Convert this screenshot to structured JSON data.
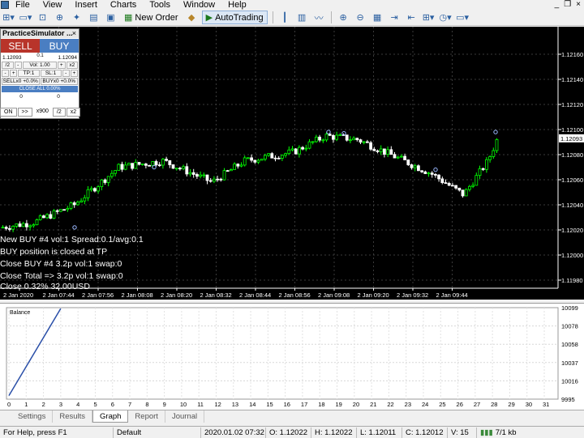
{
  "menu": {
    "items": [
      "File",
      "View",
      "Insert",
      "Charts",
      "Tools",
      "Window",
      "Help"
    ],
    "window_controls": [
      "_",
      "❐",
      "×"
    ]
  },
  "toolbar": {
    "new_order": "New Order",
    "autotrading": "AutoTrading"
  },
  "simulator": {
    "title": "PracticeSimulator ...",
    "close": "×",
    "sell": "SELL",
    "buy": "BUY",
    "spread": "0.1",
    "bid": "1.12093",
    "ask": "1.12094",
    "half": "/2",
    "vol": "Vol: 1.00",
    "double": "x2",
    "tp": "TP:1",
    "sl": "SL:1",
    "minus": "-",
    "plus": "+",
    "sell_status": "SELLx0 +0.0%",
    "buy_status": "BUYx0 +0.0%",
    "close_all": "CLOSE ALL 0.00%",
    "sell_count": "0",
    "buy_count": "0",
    "speed_on": "ON",
    "speed_ff": ">>",
    "speed_x900": "x900",
    "speed_half": "/2",
    "speed_x2": "x2"
  },
  "chart": {
    "price_labels": [
      "1.12160",
      "1.12140",
      "1.12120",
      "1.12100",
      "1.12080",
      "1.12060",
      "1.12040",
      "1.12020",
      "1.12000",
      "1.11980"
    ],
    "current_price": "1.12093",
    "time_labels": [
      "2 Jan 2020",
      "2 Jan 07:44",
      "2 Jan 07:56",
      "2 Jan 08:08",
      "2 Jan 08:20",
      "2 Jan 08:32",
      "2 Jan 08:44",
      "2 Jan 08:56",
      "2 Jan 09:08",
      "2 Jan 09:20",
      "2 Jan 09:32",
      "2 Jan 09:44"
    ],
    "overlay_lines": [
      "New BUY #4 vol:1 Spread:0.1/avg:0.1",
      "BUY position is closed at TP",
      "Close BUY #4 3.2p vol:1 swap:0",
      "Close Total => 3.2p vol:1 swap:0",
      "Close 0.32% 32.00USD"
    ],
    "colors": {
      "up": "#00ff00",
      "down": "#ffffff",
      "grid": "#3a3a3a",
      "bg": "#000000"
    }
  },
  "balance": {
    "title": "Balance",
    "y_labels": [
      "10099",
      "10078",
      "10058",
      "10037",
      "10016",
      "9995"
    ],
    "x_labels": [
      "0",
      "1",
      "2",
      "3",
      "4",
      "5",
      "6",
      "7",
      "8",
      "9",
      "10",
      "11",
      "12",
      "13",
      "14",
      "15",
      "16",
      "17",
      "18",
      "19",
      "20",
      "21",
      "22",
      "23",
      "24",
      "25",
      "26",
      "27",
      "28",
      "29",
      "30",
      "31"
    ],
    "line_color": "#2a4fa8"
  },
  "tabs": [
    "Settings",
    "Results",
    "Graph",
    "Report",
    "Journal"
  ],
  "active_tab": "Graph",
  "status": {
    "help": "For Help, press F1",
    "profile": "Default",
    "time": "2020.01.02 07:32",
    "open": "O: 1.12022",
    "high": "H: 1.12022",
    "low": "L: 1.12011",
    "close": "C: 1.12012",
    "volume": "V: 15",
    "traffic": "7/1 kb"
  }
}
